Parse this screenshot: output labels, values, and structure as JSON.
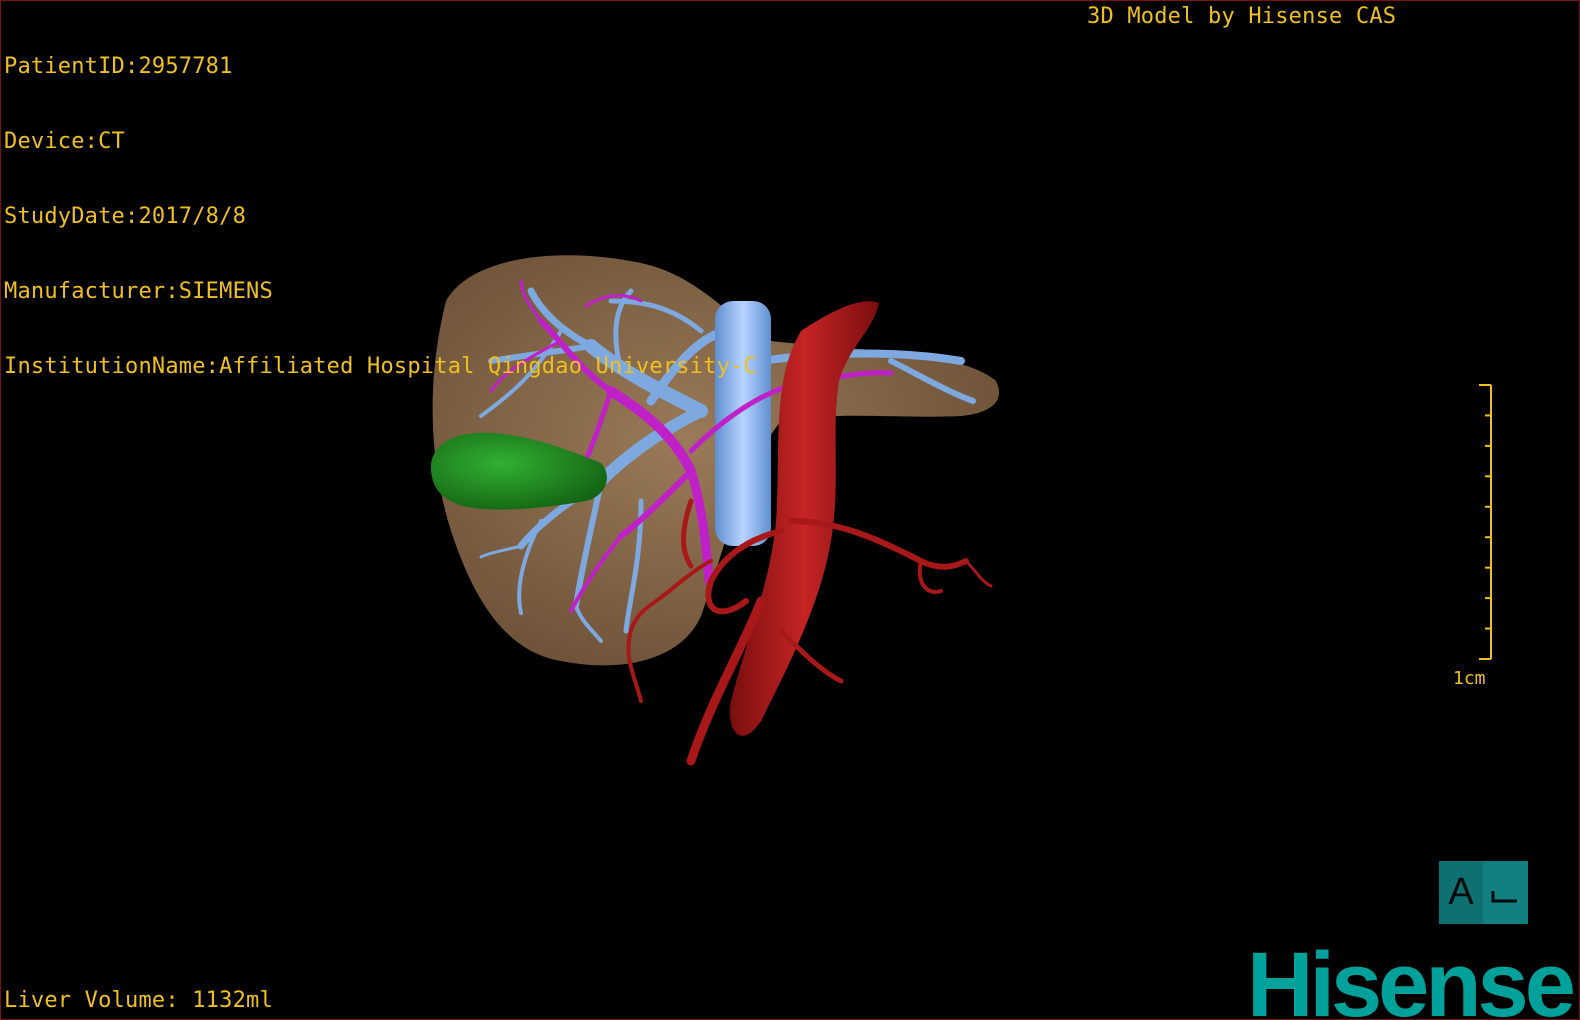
{
  "overlay": {
    "patient_id": "PatientID:2957781",
    "device": "Device:CT",
    "study_date": "StudyDate:2017/8/8",
    "manufacturer": "Manufacturer:SIEMENS",
    "institution": "InstitutionName:Affiliated Hospital Qingdao University-C",
    "model_credit": "3D Model by Hisense CAS",
    "liver_volume": "Liver Volume: 1132ml"
  },
  "scale": {
    "label": "1cm",
    "ticks": 9
  },
  "orientation": {
    "face_label": "A"
  },
  "brand": {
    "logo": "Hisense"
  },
  "colors": {
    "overlay_text": "#f0c020",
    "liver": "#8a6b4c",
    "portal_vein": "#7ea9e0",
    "hepatic_artery": "#c020c8",
    "aorta": "#a81818",
    "gallbladder": "#1e8a1e",
    "brand": "#00a19a",
    "orientation_cube": "#127f80"
  }
}
